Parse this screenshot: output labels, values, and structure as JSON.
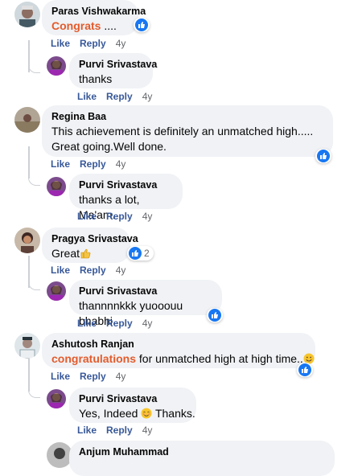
{
  "actions": {
    "like": "Like",
    "reply": "Reply"
  },
  "comments": [
    {
      "author": "Paras Vishwakarma",
      "highlight": "Congrats",
      "text": " ....",
      "age": "4y",
      "reactions": ""
    },
    {
      "author": "Purvi Srivastava",
      "text": "thanks",
      "age": "4y"
    },
    {
      "author": "Regina Baa",
      "line1": "This achievement is definitely an unmatched high.....",
      "line2": "Great going.Well done.",
      "age": "4y"
    },
    {
      "author": "Purvi Srivastava",
      "text": "thanks a lot, Ma'am.",
      "age": "4y"
    },
    {
      "author": "Pragya Srivastava",
      "text": "Great",
      "age": "4y",
      "reaction_count": "2"
    },
    {
      "author": "Purvi Srivastava",
      "text": "thannnnkkk yuooouu bhabhi",
      "age": "4y"
    },
    {
      "author": "Ashutosh Ranjan",
      "highlight": "congratulations",
      "text": " for unmatched high at high time..",
      "age": "4y"
    },
    {
      "author": "Purvi Srivastava",
      "text_before": "Yes, Indeed ",
      "text_after": " Thanks.",
      "age": "4y"
    },
    {
      "author": "Anjum Muhammad"
    }
  ],
  "colors": {
    "bubble": "#f0f2f5",
    "link": "#385898",
    "highlight": "#e35b2c",
    "like_blue": "#1877f2"
  }
}
